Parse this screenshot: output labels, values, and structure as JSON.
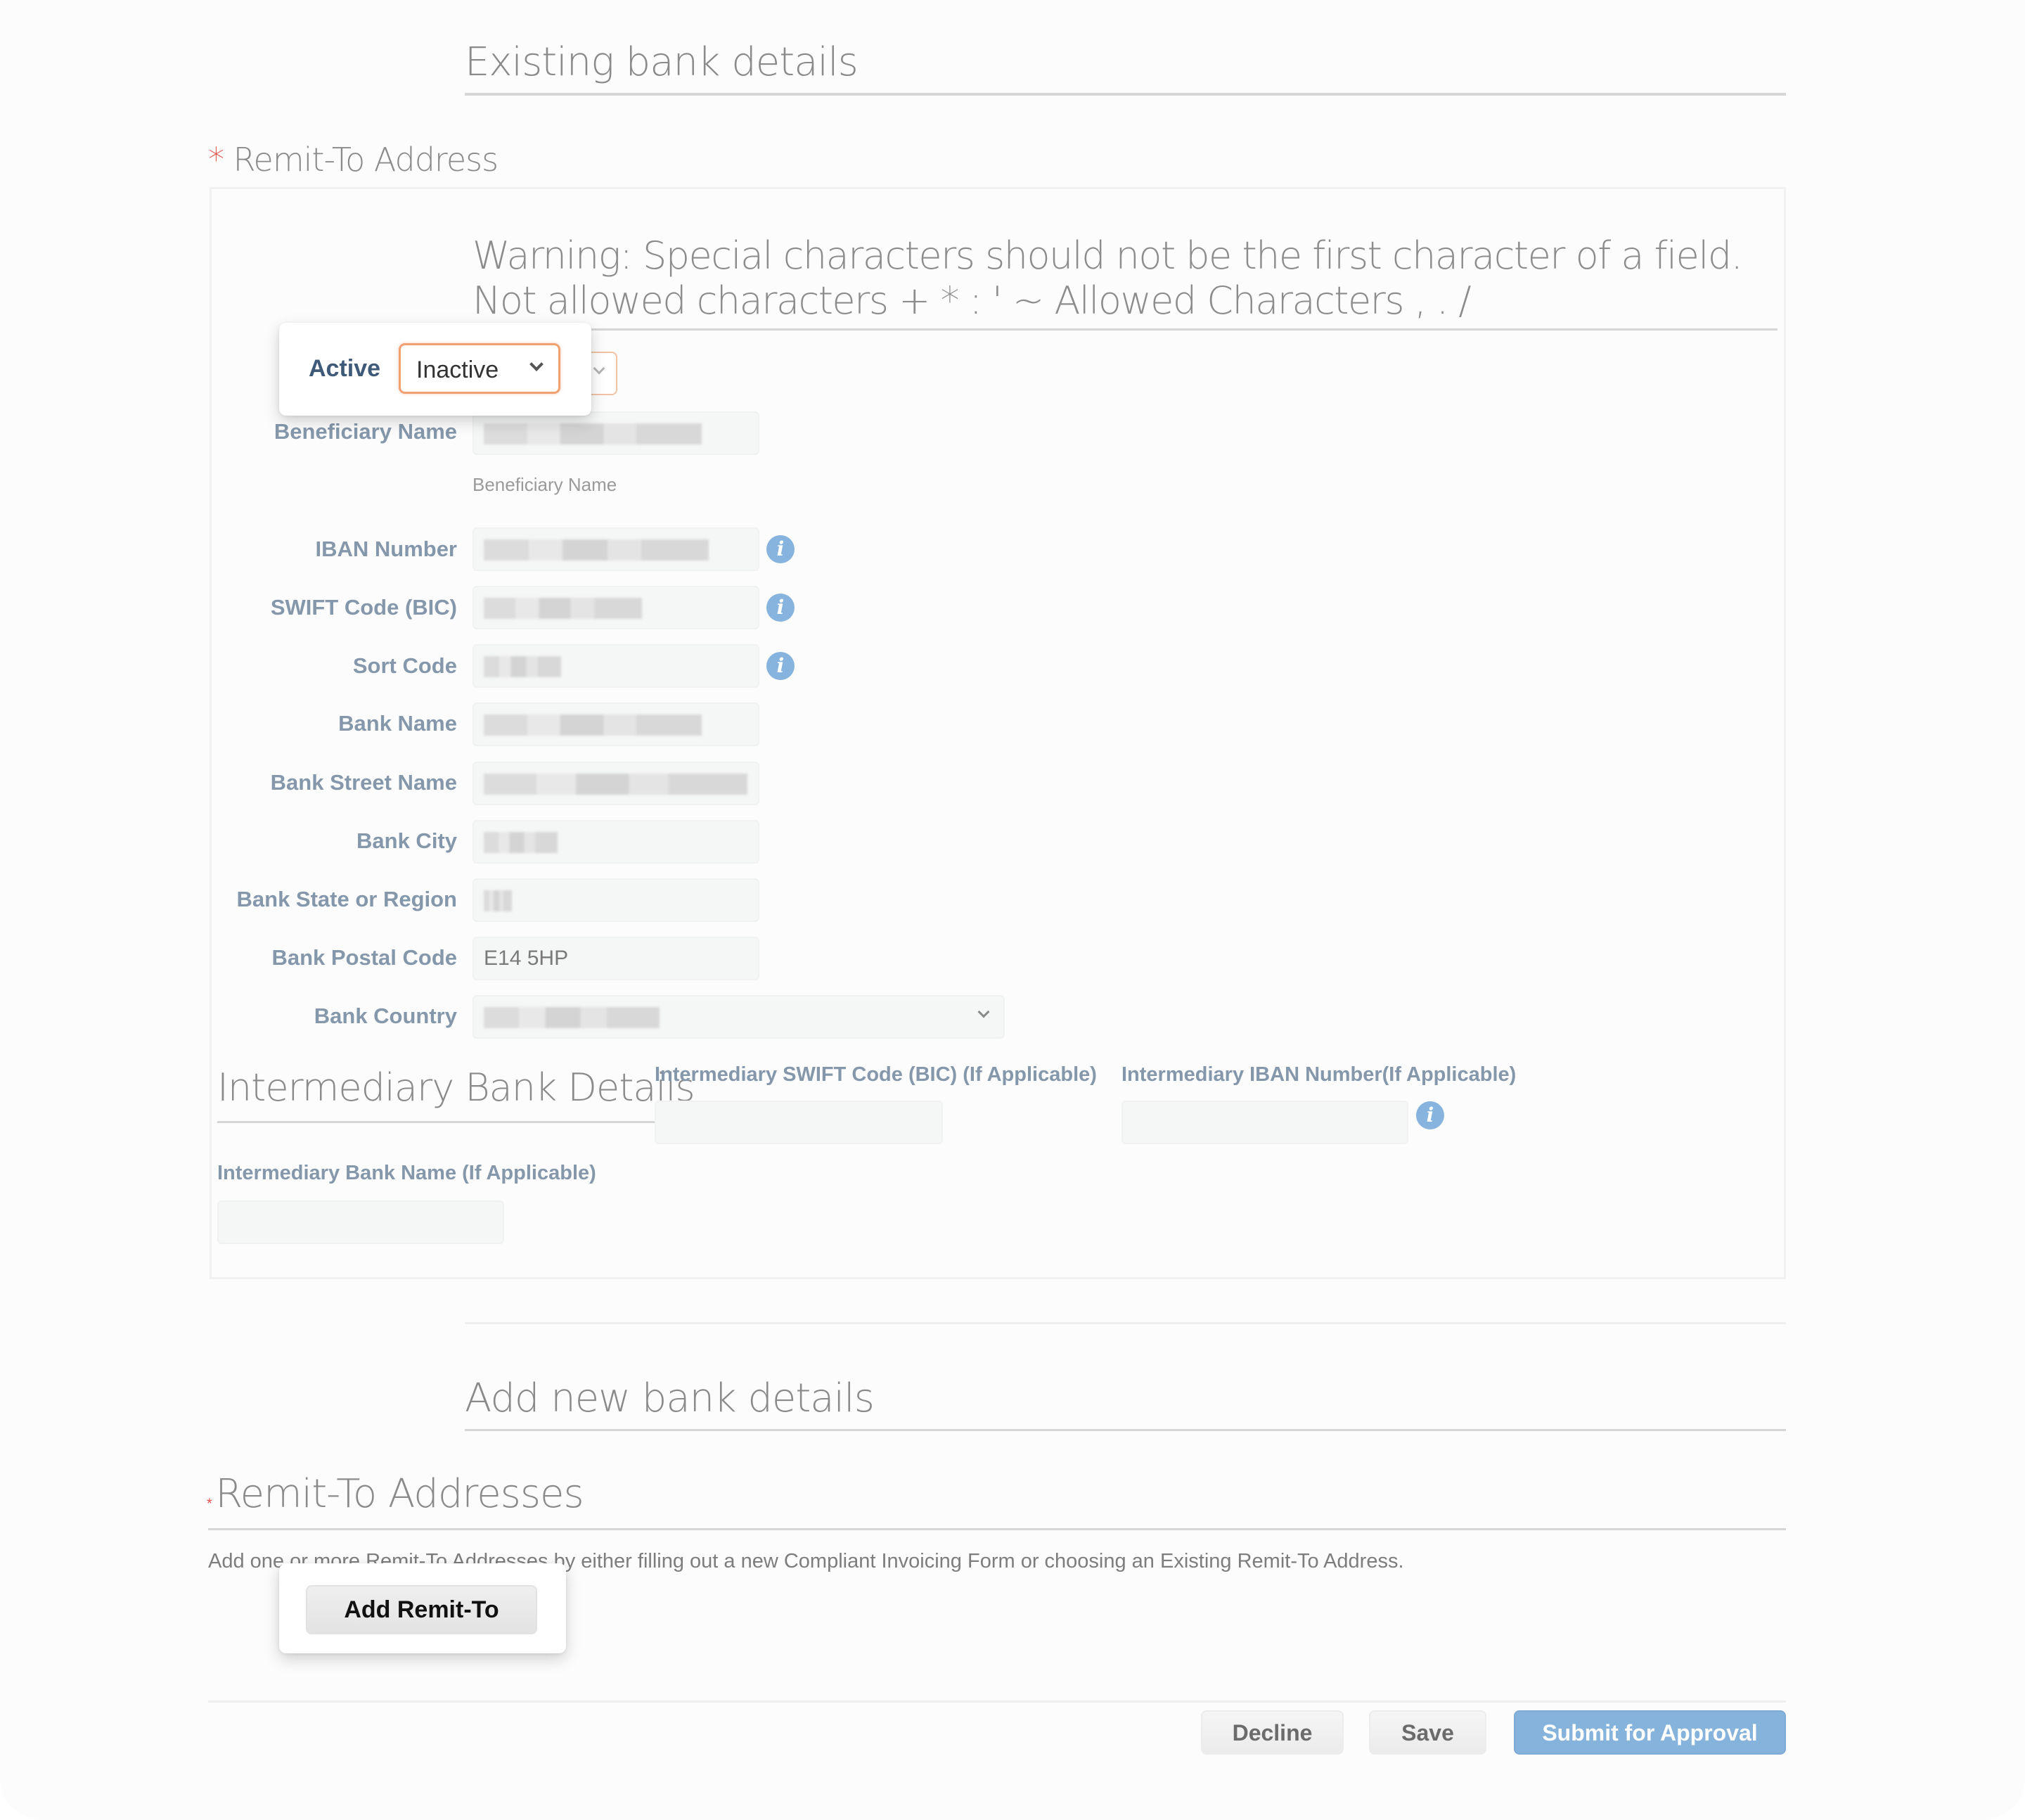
{
  "existing_section": {
    "heading": "Existing bank details",
    "remit_to_label": "Remit-To Address",
    "required_marker": "*",
    "warning": "Warning: Special characters should not be the first character of a field. Not allowed characters + * : ' ~ Allowed Characters , . /",
    "status_popover": {
      "label": "Active",
      "selected": "Inactive"
    },
    "fields": [
      {
        "label": "Beneficiary Name",
        "value": "[redacted]",
        "hint": "Beneficiary Name",
        "info": false
      },
      {
        "label": "IBAN Number",
        "value": "[redacted]",
        "info": true
      },
      {
        "label": "SWIFT Code (BIC)",
        "value": "[redacted]",
        "info": true
      },
      {
        "label": "Sort Code",
        "value": "[redacted]",
        "info": true
      },
      {
        "label": "Bank Name",
        "value": "[redacted]",
        "info": false
      },
      {
        "label": "Bank Street Name",
        "value": "[redacted]",
        "info": false
      },
      {
        "label": "Bank City",
        "value": "[redacted]",
        "info": false
      },
      {
        "label": "Bank State or Region",
        "value": "[redacted]",
        "info": false
      },
      {
        "label": "Bank Postal Code",
        "value": "E14 5HP",
        "info": false
      },
      {
        "label": "Bank Country",
        "value": "[redacted]",
        "type": "select",
        "info": false
      }
    ],
    "intermediary": {
      "heading": "Intermediary Bank Details",
      "swift_label": "Intermediary SWIFT Code (BIC) (If Applicable)",
      "swift_value": "",
      "iban_label": "Intermediary IBAN Number(If Applicable)",
      "iban_value": "",
      "bank_name_label": "Intermediary Bank Name (If Applicable)",
      "bank_name_value": ""
    }
  },
  "new_section": {
    "heading": "Add new bank details",
    "remit_to_heading": "Remit-To Addresses",
    "required_marker": "*",
    "description": "Add one or more Remit-To Addresses by either filling out a new Compliant Invoicing Form or choosing an Existing Remit-To Address.",
    "add_button": "Add Remit-To"
  },
  "footer": {
    "decline": "Decline",
    "save": "Save",
    "submit": "Submit for Approval"
  },
  "icons": {
    "info": "info-icon",
    "dropdown": "chevron-down-icon"
  },
  "colors": {
    "label": "#8497ab",
    "active_label": "#3f5a78",
    "info_icon": "#86b4de",
    "submit_button": "#86b3dc",
    "focus_border": "#f0a071",
    "required": "#e0534a"
  }
}
